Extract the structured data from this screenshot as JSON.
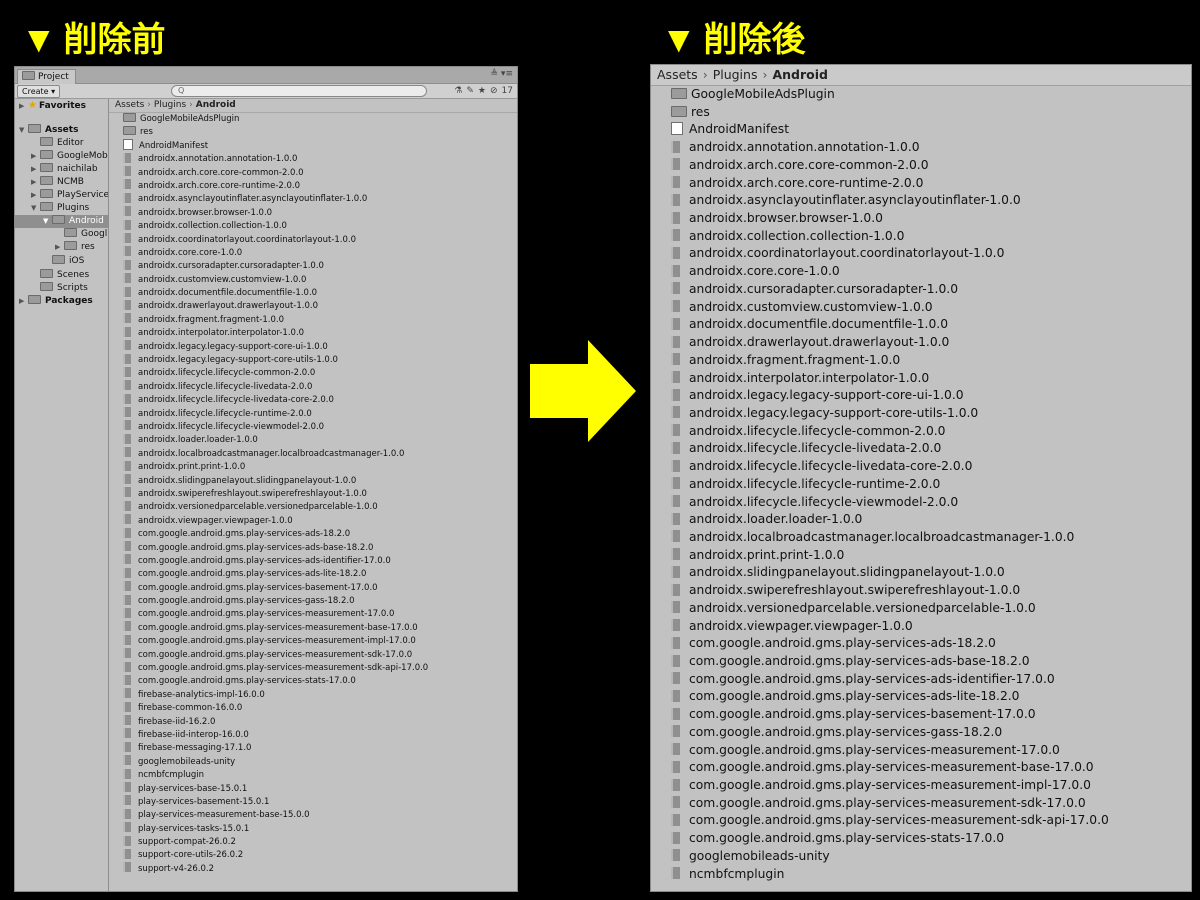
{
  "headings": {
    "before": {
      "marker": "▼",
      "text": "削除前"
    },
    "after": {
      "marker": "▼",
      "text": "削除後"
    }
  },
  "colors": {
    "accent": "#ffff00",
    "background": "#000000",
    "panel": "#c2c2c2",
    "selection": "#8f8f8f"
  },
  "left_panel": {
    "tab_label": "Project",
    "window_controls": "≜ ▾≡",
    "create_label": "Create ▾",
    "search_placeholder": "Q",
    "toolbar_icons": [
      "tag-icon",
      "label-icon",
      "star-icon"
    ],
    "hidden_count": "17",
    "breadcrumb": [
      "Assets",
      "Plugins",
      "Android"
    ],
    "tree": [
      {
        "label": "Favorites",
        "bold": true,
        "arrow": "▶",
        "icon": "star"
      },
      {
        "label": "Assets",
        "bold": true,
        "arrow": "▼",
        "icon": "folder"
      },
      {
        "label": "Editor",
        "arrow": "",
        "icon": "folder"
      },
      {
        "label": "GoogleMob",
        "arrow": "▶",
        "icon": "folder"
      },
      {
        "label": "naichilab",
        "arrow": "▶",
        "icon": "folder"
      },
      {
        "label": "NCMB",
        "arrow": "▶",
        "icon": "folder"
      },
      {
        "label": "PlayService",
        "arrow": "▶",
        "icon": "folder"
      },
      {
        "label": "Plugins",
        "arrow": "▼",
        "icon": "folder"
      },
      {
        "label": "Android",
        "arrow": "▼",
        "icon": "folder",
        "selected": true
      },
      {
        "label": "Googl",
        "arrow": "",
        "icon": "folder"
      },
      {
        "label": "res",
        "arrow": "▶",
        "icon": "folder"
      },
      {
        "label": "iOS",
        "arrow": "",
        "icon": "folder"
      },
      {
        "label": "Scenes",
        "arrow": "",
        "icon": "folder"
      },
      {
        "label": "Scripts",
        "arrow": "",
        "icon": "folder"
      },
      {
        "label": "Packages",
        "bold": true,
        "arrow": "▶",
        "icon": "folder"
      }
    ],
    "items": [
      {
        "name": "GoogleMobileAdsPlugin",
        "icon": "folder"
      },
      {
        "name": "res",
        "icon": "folder"
      },
      {
        "name": "AndroidManifest",
        "icon": "file"
      },
      {
        "name": "androidx.annotation.annotation-1.0.0",
        "icon": "lib"
      },
      {
        "name": "androidx.arch.core.core-common-2.0.0",
        "icon": "lib"
      },
      {
        "name": "androidx.arch.core.core-runtime-2.0.0",
        "icon": "lib"
      },
      {
        "name": "androidx.asynclayoutinflater.asynclayoutinflater-1.0.0",
        "icon": "lib"
      },
      {
        "name": "androidx.browser.browser-1.0.0",
        "icon": "lib"
      },
      {
        "name": "androidx.collection.collection-1.0.0",
        "icon": "lib"
      },
      {
        "name": "androidx.coordinatorlayout.coordinatorlayout-1.0.0",
        "icon": "lib"
      },
      {
        "name": "androidx.core.core-1.0.0",
        "icon": "lib"
      },
      {
        "name": "androidx.cursoradapter.cursoradapter-1.0.0",
        "icon": "lib"
      },
      {
        "name": "androidx.customview.customview-1.0.0",
        "icon": "lib"
      },
      {
        "name": "androidx.documentfile.documentfile-1.0.0",
        "icon": "lib"
      },
      {
        "name": "androidx.drawerlayout.drawerlayout-1.0.0",
        "icon": "lib"
      },
      {
        "name": "androidx.fragment.fragment-1.0.0",
        "icon": "lib"
      },
      {
        "name": "androidx.interpolator.interpolator-1.0.0",
        "icon": "lib"
      },
      {
        "name": "androidx.legacy.legacy-support-core-ui-1.0.0",
        "icon": "lib"
      },
      {
        "name": "androidx.legacy.legacy-support-core-utils-1.0.0",
        "icon": "lib"
      },
      {
        "name": "androidx.lifecycle.lifecycle-common-2.0.0",
        "icon": "lib"
      },
      {
        "name": "androidx.lifecycle.lifecycle-livedata-2.0.0",
        "icon": "lib"
      },
      {
        "name": "androidx.lifecycle.lifecycle-livedata-core-2.0.0",
        "icon": "lib"
      },
      {
        "name": "androidx.lifecycle.lifecycle-runtime-2.0.0",
        "icon": "lib"
      },
      {
        "name": "androidx.lifecycle.lifecycle-viewmodel-2.0.0",
        "icon": "lib"
      },
      {
        "name": "androidx.loader.loader-1.0.0",
        "icon": "lib"
      },
      {
        "name": "androidx.localbroadcastmanager.localbroadcastmanager-1.0.0",
        "icon": "lib"
      },
      {
        "name": "androidx.print.print-1.0.0",
        "icon": "lib"
      },
      {
        "name": "androidx.slidingpanelayout.slidingpanelayout-1.0.0",
        "icon": "lib"
      },
      {
        "name": "androidx.swiperefreshlayout.swiperefreshlayout-1.0.0",
        "icon": "lib"
      },
      {
        "name": "androidx.versionedparcelable.versionedparcelable-1.0.0",
        "icon": "lib"
      },
      {
        "name": "androidx.viewpager.viewpager-1.0.0",
        "icon": "lib"
      },
      {
        "name": "com.google.android.gms.play-services-ads-18.2.0",
        "icon": "lib"
      },
      {
        "name": "com.google.android.gms.play-services-ads-base-18.2.0",
        "icon": "lib"
      },
      {
        "name": "com.google.android.gms.play-services-ads-identifier-17.0.0",
        "icon": "lib"
      },
      {
        "name": "com.google.android.gms.play-services-ads-lite-18.2.0",
        "icon": "lib"
      },
      {
        "name": "com.google.android.gms.play-services-basement-17.0.0",
        "icon": "lib"
      },
      {
        "name": "com.google.android.gms.play-services-gass-18.2.0",
        "icon": "lib"
      },
      {
        "name": "com.google.android.gms.play-services-measurement-17.0.0",
        "icon": "lib"
      },
      {
        "name": "com.google.android.gms.play-services-measurement-base-17.0.0",
        "icon": "lib"
      },
      {
        "name": "com.google.android.gms.play-services-measurement-impl-17.0.0",
        "icon": "lib"
      },
      {
        "name": "com.google.android.gms.play-services-measurement-sdk-17.0.0",
        "icon": "lib"
      },
      {
        "name": "com.google.android.gms.play-services-measurement-sdk-api-17.0.0",
        "icon": "lib"
      },
      {
        "name": "com.google.android.gms.play-services-stats-17.0.0",
        "icon": "lib"
      },
      {
        "name": "firebase-analytics-impl-16.0.0",
        "icon": "lib"
      },
      {
        "name": "firebase-common-16.0.0",
        "icon": "lib"
      },
      {
        "name": "firebase-iid-16.2.0",
        "icon": "lib"
      },
      {
        "name": "firebase-iid-interop-16.0.0",
        "icon": "lib"
      },
      {
        "name": "firebase-messaging-17.1.0",
        "icon": "lib"
      },
      {
        "name": "googlemobileads-unity",
        "icon": "lib"
      },
      {
        "name": "ncmbfcmplugin",
        "icon": "lib"
      },
      {
        "name": "play-services-base-15.0.1",
        "icon": "lib"
      },
      {
        "name": "play-services-basement-15.0.1",
        "icon": "lib"
      },
      {
        "name": "play-services-measurement-base-15.0.0",
        "icon": "lib"
      },
      {
        "name": "play-services-tasks-15.0.1",
        "icon": "lib"
      },
      {
        "name": "support-compat-26.0.2",
        "icon": "lib"
      },
      {
        "name": "support-core-utils-26.0.2",
        "icon": "lib"
      },
      {
        "name": "support-v4-26.0.2",
        "icon": "lib"
      }
    ]
  },
  "right_panel": {
    "breadcrumb": [
      "Assets",
      "Plugins",
      "Android"
    ],
    "items": [
      {
        "name": "GoogleMobileAdsPlugin",
        "icon": "folder"
      },
      {
        "name": "res",
        "icon": "folder"
      },
      {
        "name": "AndroidManifest",
        "icon": "file"
      },
      {
        "name": "androidx.annotation.annotation-1.0.0",
        "icon": "lib"
      },
      {
        "name": "androidx.arch.core.core-common-2.0.0",
        "icon": "lib"
      },
      {
        "name": "androidx.arch.core.core-runtime-2.0.0",
        "icon": "lib"
      },
      {
        "name": "androidx.asynclayoutinflater.asynclayoutinflater-1.0.0",
        "icon": "lib"
      },
      {
        "name": "androidx.browser.browser-1.0.0",
        "icon": "lib"
      },
      {
        "name": "androidx.collection.collection-1.0.0",
        "icon": "lib"
      },
      {
        "name": "androidx.coordinatorlayout.coordinatorlayout-1.0.0",
        "icon": "lib"
      },
      {
        "name": "androidx.core.core-1.0.0",
        "icon": "lib"
      },
      {
        "name": "androidx.cursoradapter.cursoradapter-1.0.0",
        "icon": "lib"
      },
      {
        "name": "androidx.customview.customview-1.0.0",
        "icon": "lib"
      },
      {
        "name": "androidx.documentfile.documentfile-1.0.0",
        "icon": "lib"
      },
      {
        "name": "androidx.drawerlayout.drawerlayout-1.0.0",
        "icon": "lib"
      },
      {
        "name": "androidx.fragment.fragment-1.0.0",
        "icon": "lib"
      },
      {
        "name": "androidx.interpolator.interpolator-1.0.0",
        "icon": "lib"
      },
      {
        "name": "androidx.legacy.legacy-support-core-ui-1.0.0",
        "icon": "lib"
      },
      {
        "name": "androidx.legacy.legacy-support-core-utils-1.0.0",
        "icon": "lib"
      },
      {
        "name": "androidx.lifecycle.lifecycle-common-2.0.0",
        "icon": "lib"
      },
      {
        "name": "androidx.lifecycle.lifecycle-livedata-2.0.0",
        "icon": "lib"
      },
      {
        "name": "androidx.lifecycle.lifecycle-livedata-core-2.0.0",
        "icon": "lib"
      },
      {
        "name": "androidx.lifecycle.lifecycle-runtime-2.0.0",
        "icon": "lib"
      },
      {
        "name": "androidx.lifecycle.lifecycle-viewmodel-2.0.0",
        "icon": "lib"
      },
      {
        "name": "androidx.loader.loader-1.0.0",
        "icon": "lib"
      },
      {
        "name": "androidx.localbroadcastmanager.localbroadcastmanager-1.0.0",
        "icon": "lib"
      },
      {
        "name": "androidx.print.print-1.0.0",
        "icon": "lib"
      },
      {
        "name": "androidx.slidingpanelayout.slidingpanelayout-1.0.0",
        "icon": "lib"
      },
      {
        "name": "androidx.swiperefreshlayout.swiperefreshlayout-1.0.0",
        "icon": "lib"
      },
      {
        "name": "androidx.versionedparcelable.versionedparcelable-1.0.0",
        "icon": "lib"
      },
      {
        "name": "androidx.viewpager.viewpager-1.0.0",
        "icon": "lib"
      },
      {
        "name": "com.google.android.gms.play-services-ads-18.2.0",
        "icon": "lib"
      },
      {
        "name": "com.google.android.gms.play-services-ads-base-18.2.0",
        "icon": "lib"
      },
      {
        "name": "com.google.android.gms.play-services-ads-identifier-17.0.0",
        "icon": "lib"
      },
      {
        "name": "com.google.android.gms.play-services-ads-lite-18.2.0",
        "icon": "lib"
      },
      {
        "name": "com.google.android.gms.play-services-basement-17.0.0",
        "icon": "lib"
      },
      {
        "name": "com.google.android.gms.play-services-gass-18.2.0",
        "icon": "lib"
      },
      {
        "name": "com.google.android.gms.play-services-measurement-17.0.0",
        "icon": "lib"
      },
      {
        "name": "com.google.android.gms.play-services-measurement-base-17.0.0",
        "icon": "lib"
      },
      {
        "name": "com.google.android.gms.play-services-measurement-impl-17.0.0",
        "icon": "lib"
      },
      {
        "name": "com.google.android.gms.play-services-measurement-sdk-17.0.0",
        "icon": "lib"
      },
      {
        "name": "com.google.android.gms.play-services-measurement-sdk-api-17.0.0",
        "icon": "lib"
      },
      {
        "name": "com.google.android.gms.play-services-stats-17.0.0",
        "icon": "lib"
      },
      {
        "name": "googlemobileads-unity",
        "icon": "lib"
      },
      {
        "name": "ncmbfcmplugin",
        "icon": "lib"
      }
    ]
  }
}
